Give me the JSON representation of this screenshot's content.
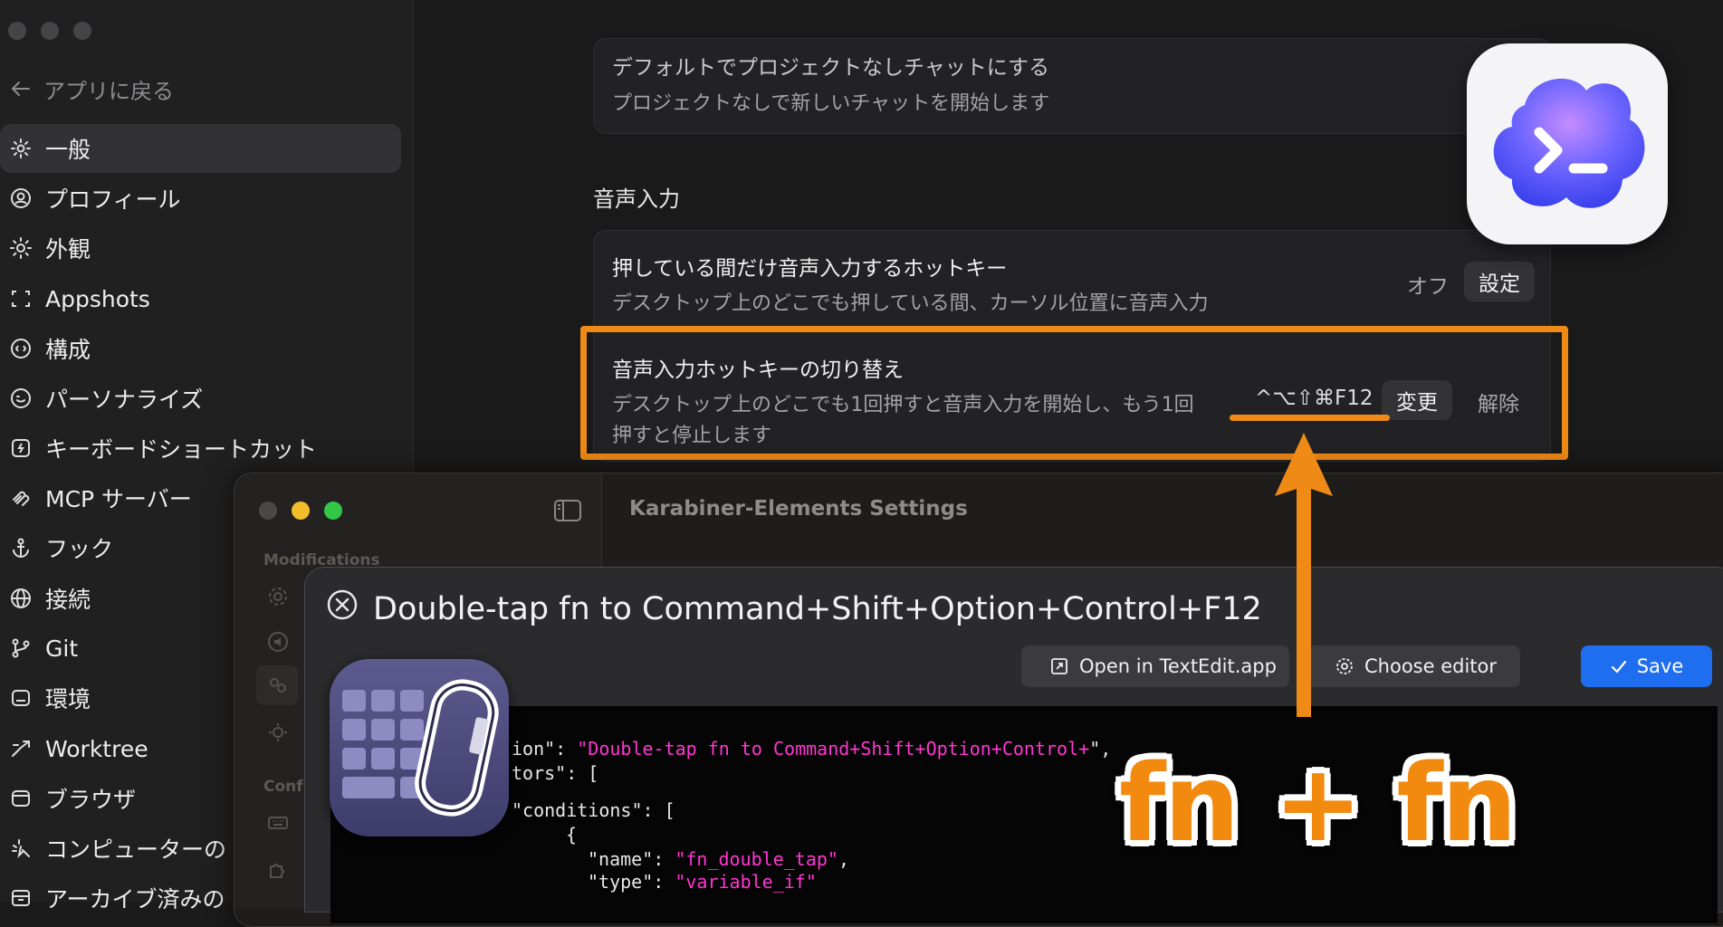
{
  "sidebar": {
    "back_label": "アプリに戻る",
    "items": [
      {
        "label": "一般",
        "icon": "gear-icon",
        "active": true
      },
      {
        "label": "プロフィール",
        "icon": "profile-icon"
      },
      {
        "label": "外観",
        "icon": "sun-icon"
      },
      {
        "label": "Appshots",
        "icon": "screenshot-icon"
      },
      {
        "label": "構成",
        "icon": "config-icon"
      },
      {
        "label": "パーソナライズ",
        "icon": "personalize-icon"
      },
      {
        "label": "キーボードショートカット",
        "icon": "keyboard-shortcut-icon"
      },
      {
        "label": "MCP サーバー",
        "icon": "mcp-icon"
      },
      {
        "label": "フック",
        "icon": "anchor-icon"
      },
      {
        "label": "接続",
        "icon": "globe-icon"
      },
      {
        "label": "Git",
        "icon": "git-branch-icon"
      },
      {
        "label": "環境",
        "icon": "environment-icon"
      },
      {
        "label": "Worktree",
        "icon": "worktree-icon"
      },
      {
        "label": "ブラウザ",
        "icon": "browser-icon"
      },
      {
        "label": "コンピューターの",
        "icon": "computer-use-icon"
      },
      {
        "label": "アーカイブ済みの",
        "icon": "archive-icon"
      }
    ]
  },
  "main": {
    "top_card": {
      "title_partial": "デフォルトでプロジェクトなしチャットにする",
      "description": "プロジェクトなしで新しいチャットを開始します"
    },
    "voice_section_label": "音声入力",
    "push_to_talk": {
      "title": "押している間だけ音声入力するホットキー",
      "description": "デスクトップ上のどこでも押している間、カーソル位置に音声入力",
      "status": "オフ",
      "button": "設定"
    },
    "toggle_hotkey": {
      "title": "音声入力ホットキーの切り替え",
      "description_line1": "デスクトップ上のどこでも1回押すと音声入力を開始し、もう1回",
      "description_line2": "押すと停止します",
      "shortcut": "^⌥⇧⌘F12",
      "change_button": "変更",
      "clear_button": "解除"
    }
  },
  "karabiner": {
    "window_title": "Karabiner-Elements Settings",
    "sidebar_section_1": "Modifications",
    "sidebar_section_2": "Conf",
    "dialog": {
      "title": "Double-tap fn to Command+Shift+Option+Control+F12",
      "open_button": "Open in TextEdit.app",
      "choose_editor_button": "Choose editor",
      "save_button": "Save",
      "code": {
        "l1_key": "ion\": ",
        "l1_val": "\"Double-tap fn to Command+Shift+Option+Control+",
        "l1_tail": "\",",
        "l2_key": "tors\": [",
        "l3_key": "\"conditions\": [",
        "l4_key": "{",
        "l5_key": "\"name\": ",
        "l5_val": "\"fn_double_tap\"",
        "l5_tail": ",",
        "l6_key": "\"type\": ",
        "l6_val": "\"variable_if\""
      }
    }
  },
  "annotation": {
    "label": "fn + fn",
    "color": "#f08a16"
  }
}
